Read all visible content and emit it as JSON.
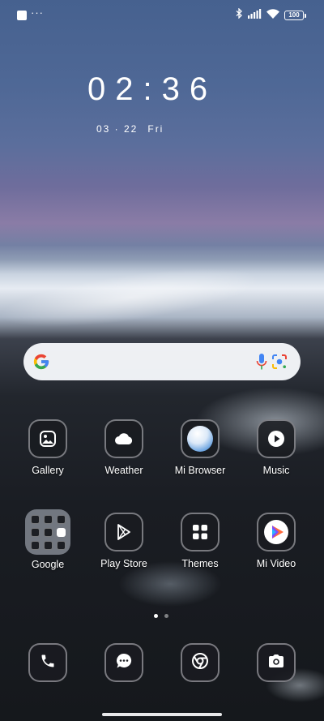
{
  "status_bar": {
    "dots": "···",
    "battery": "100",
    "icons": [
      "notification-square-icon",
      "bluetooth-icon",
      "signal-icon",
      "wifi-icon",
      "battery-icon"
    ]
  },
  "lock": {
    "time": "02:36",
    "date": "03 · 22",
    "weekday": "Fri"
  },
  "search": {
    "icons": [
      "google-g-icon",
      "mic-icon",
      "lens-icon"
    ]
  },
  "apps": {
    "row1": [
      {
        "label": "Gallery",
        "icon": "gallery-icon"
      },
      {
        "label": "Weather",
        "icon": "cloud-icon"
      },
      {
        "label": "Mi Browser",
        "icon": "browser-icon"
      },
      {
        "label": "Music",
        "icon": "play-icon"
      }
    ],
    "row2": [
      {
        "label": "Google",
        "icon": "folder-icon"
      },
      {
        "label": "Play Store",
        "icon": "play-store-icon"
      },
      {
        "label": "Themes",
        "icon": "themes-grid-icon"
      },
      {
        "label": "Mi Video",
        "icon": "mi-video-icon"
      }
    ]
  },
  "pager": {
    "pages": 2,
    "current": 1
  },
  "dock": [
    "phone-icon",
    "messages-icon",
    "chrome-icon",
    "camera-icon"
  ],
  "colors": {
    "google_blue": "#4285F4",
    "google_red": "#EA4335",
    "google_yellow": "#FBBC05",
    "google_green": "#34A853"
  }
}
